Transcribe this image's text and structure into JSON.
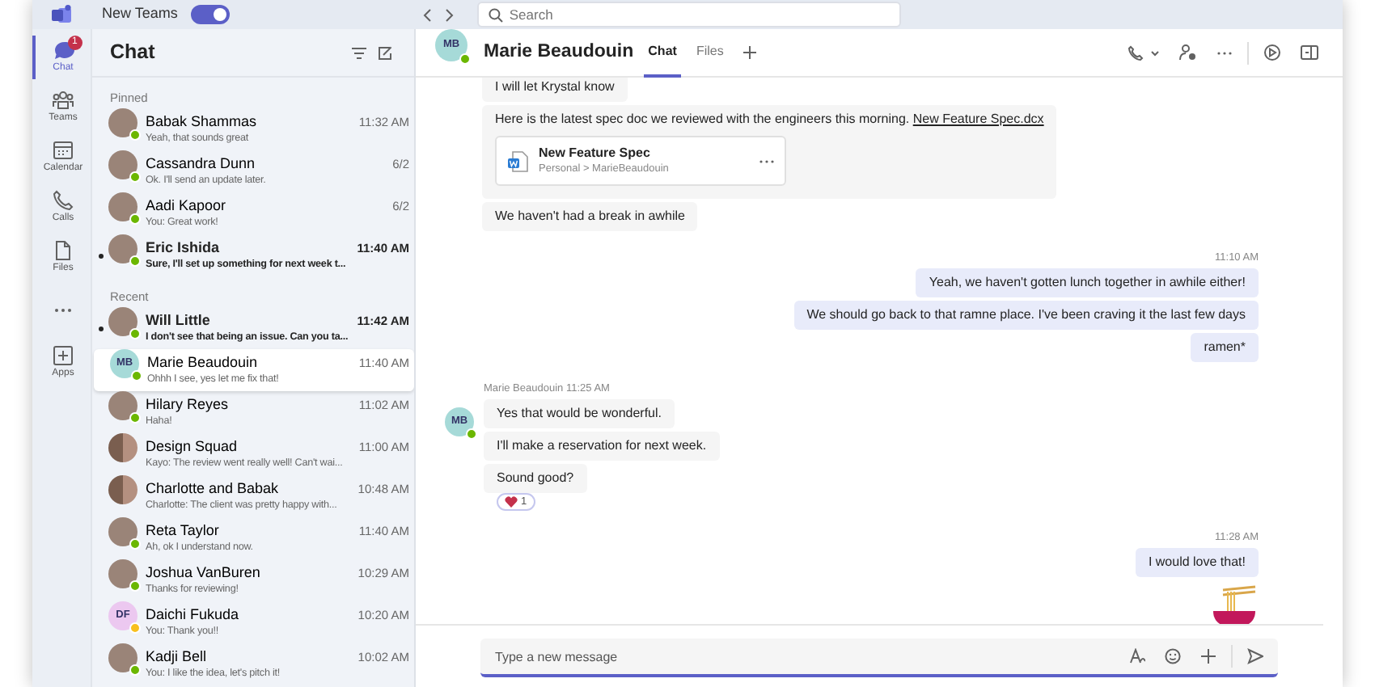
{
  "top_bar": {
    "toggle_label": "New Teams",
    "toggle_on": true,
    "search": {
      "placeholder": "Search"
    }
  },
  "rail": [
    {
      "kind": "chat",
      "label": "Chat",
      "selected": true,
      "badge": "1"
    },
    {
      "kind": "teams",
      "label": "Teams",
      "selected": false
    },
    {
      "kind": "calendar",
      "label": "Calendar",
      "selected": false
    },
    {
      "kind": "calls",
      "label": "Calls",
      "selected": false
    },
    {
      "kind": "files",
      "label": "Files",
      "selected": false
    },
    {
      "kind": "more",
      "selected": false
    },
    {
      "kind": "apps",
      "label": "Apps",
      "selected": false
    }
  ],
  "chat_list": {
    "title": "Chat",
    "sections": [
      {
        "title": "Pinned",
        "items": [
          {
            "name": "Babak Shammas",
            "time": "11:32 AM",
            "preview": "Yeah, that sounds great",
            "avatar": {
              "kind": "photo"
            },
            "presence": {
              "color": "#6bb700"
            },
            "unread": false,
            "selected": false
          },
          {
            "name": "Cassandra Dunn",
            "time": "6/2",
            "preview": "Ok. I'll send an update later.",
            "avatar": {
              "kind": "photo"
            },
            "presence": {
              "color": "#6bb700"
            },
            "unread": false,
            "selected": false
          },
          {
            "name": "Aadi Kapoor",
            "time": "6/2",
            "preview": "You: Great work!",
            "avatar": {
              "kind": "photo"
            },
            "presence": {
              "color": "#6bb700"
            },
            "unread": false,
            "selected": false
          },
          {
            "name": "Eric Ishida",
            "time": "11:40 AM",
            "preview": "Sure, I'll set up something for next week t...",
            "avatar": {
              "kind": "photo"
            },
            "presence": {
              "color": "#6bb700"
            },
            "unread": true,
            "selected": false
          }
        ]
      },
      {
        "title": "Recent",
        "items": [
          {
            "name": "Will Little",
            "time": "11:42 AM",
            "preview": "I don't see that being an issue. Can you ta...",
            "avatar": {
              "kind": "photo"
            },
            "presence": {
              "color": "#6bb700"
            },
            "unread": true,
            "selected": false
          },
          {
            "name": "Marie Beaudouin",
            "time": "11:40 AM",
            "preview": "Ohhh I see, yes let me fix that!",
            "avatar": {
              "kind": "initials",
              "initials": "MB",
              "color": "#a6dad8"
            },
            "presence": {
              "color": "#6bb700"
            },
            "unread": false,
            "selected": true
          },
          {
            "name": "Hilary Reyes",
            "time": "11:02 AM",
            "preview": "Haha!",
            "avatar": {
              "kind": "photo"
            },
            "presence": {
              "color": "#6bb700"
            },
            "unread": false,
            "selected": false
          },
          {
            "name": "Design Squad",
            "time": "11:00 AM",
            "preview": "Kayo: The review went really well! Can't wai...",
            "avatar": {
              "kind": "group"
            },
            "unread": false,
            "selected": false
          },
          {
            "name": "Charlotte and Babak",
            "time": "10:48 AM",
            "preview": "Charlotte: The client was pretty happy with...",
            "avatar": {
              "kind": "group"
            },
            "unread": false,
            "selected": false
          },
          {
            "name": "Reta Taylor",
            "time": "11:40 AM",
            "preview": "Ah, ok I understand now.",
            "avatar": {
              "kind": "photo"
            },
            "presence": {
              "color": "#6bb700"
            },
            "unread": false,
            "selected": false
          },
          {
            "name": "Joshua VanBuren",
            "time": "10:29 AM",
            "preview": "Thanks for reviewing!",
            "avatar": {
              "kind": "photo"
            },
            "presence": {
              "color": "#6bb700"
            },
            "unread": false,
            "selected": false
          },
          {
            "name": "Daichi Fukuda",
            "time": "10:20 AM",
            "preview": "You: Thank you!!",
            "avatar": {
              "kind": "initials",
              "initials": "DF",
              "color": "#ecc8f0"
            },
            "presence": {
              "color": "#f8c01e"
            },
            "unread": false,
            "selected": false
          },
          {
            "name": "Kadji Bell",
            "time": "10:02 AM",
            "preview": "You: I like the idea, let's pitch it!",
            "avatar": {
              "kind": "photo"
            },
            "presence": {
              "color": "#6bb700"
            },
            "unread": false,
            "selected": false
          }
        ]
      }
    ]
  },
  "conversation": {
    "title": "Marie Beaudouin",
    "avatar": {
      "kind": "initials",
      "initials": "MB",
      "color": "#a6dad8"
    },
    "presence": {
      "color": "#6bb700"
    },
    "tabs": [
      {
        "label": "Chat",
        "selected": true
      },
      {
        "label": "Files",
        "selected": false
      }
    ],
    "groups": [
      {
        "kind": "incoming",
        "messages": [
          {
            "kind": "text",
            "text": "I will let Krystal know"
          },
          {
            "kind": "file",
            "text": "Here is the latest spec doc we reviewed with the engineers this morning.",
            "link": "New Feature Spec.dcx",
            "file_name": "New Feature Spec",
            "file_path": "Personal > MarieBeaudouin"
          },
          {
            "kind": "text",
            "text": "We haven't had a break in awhile"
          }
        ]
      },
      {
        "kind": "outgoing",
        "time": "11:10 AM",
        "messages": [
          {
            "kind": "text",
            "text": "Yeah, we haven't gotten lunch together in awhile either!"
          },
          {
            "kind": "text",
            "text": "We should go back to that ramne place. I've been craving it the last few days"
          },
          {
            "kind": "text",
            "text": "ramen*"
          }
        ]
      },
      {
        "kind": "incoming",
        "sender": "Marie Beaudouin",
        "time": "11:25 AM",
        "avatar": {
          "kind": "initials",
          "initials": "MB",
          "color": "#a6dad8"
        },
        "presence": {
          "color": "#6bb700"
        },
        "messages": [
          {
            "kind": "text",
            "text": "Yes that would be wonderful."
          },
          {
            "kind": "text",
            "text": "I'll make a reservation for next week."
          },
          {
            "kind": "text",
            "text": "Sound good?",
            "reaction": {
              "count": "1"
            }
          }
        ]
      },
      {
        "kind": "outgoing",
        "time": "11:28 AM",
        "messages": [
          {
            "kind": "text",
            "text": "I would love that!"
          },
          {
            "kind": "sticker"
          }
        ]
      }
    ],
    "compose": {
      "placeholder": "Type a new message"
    }
  }
}
